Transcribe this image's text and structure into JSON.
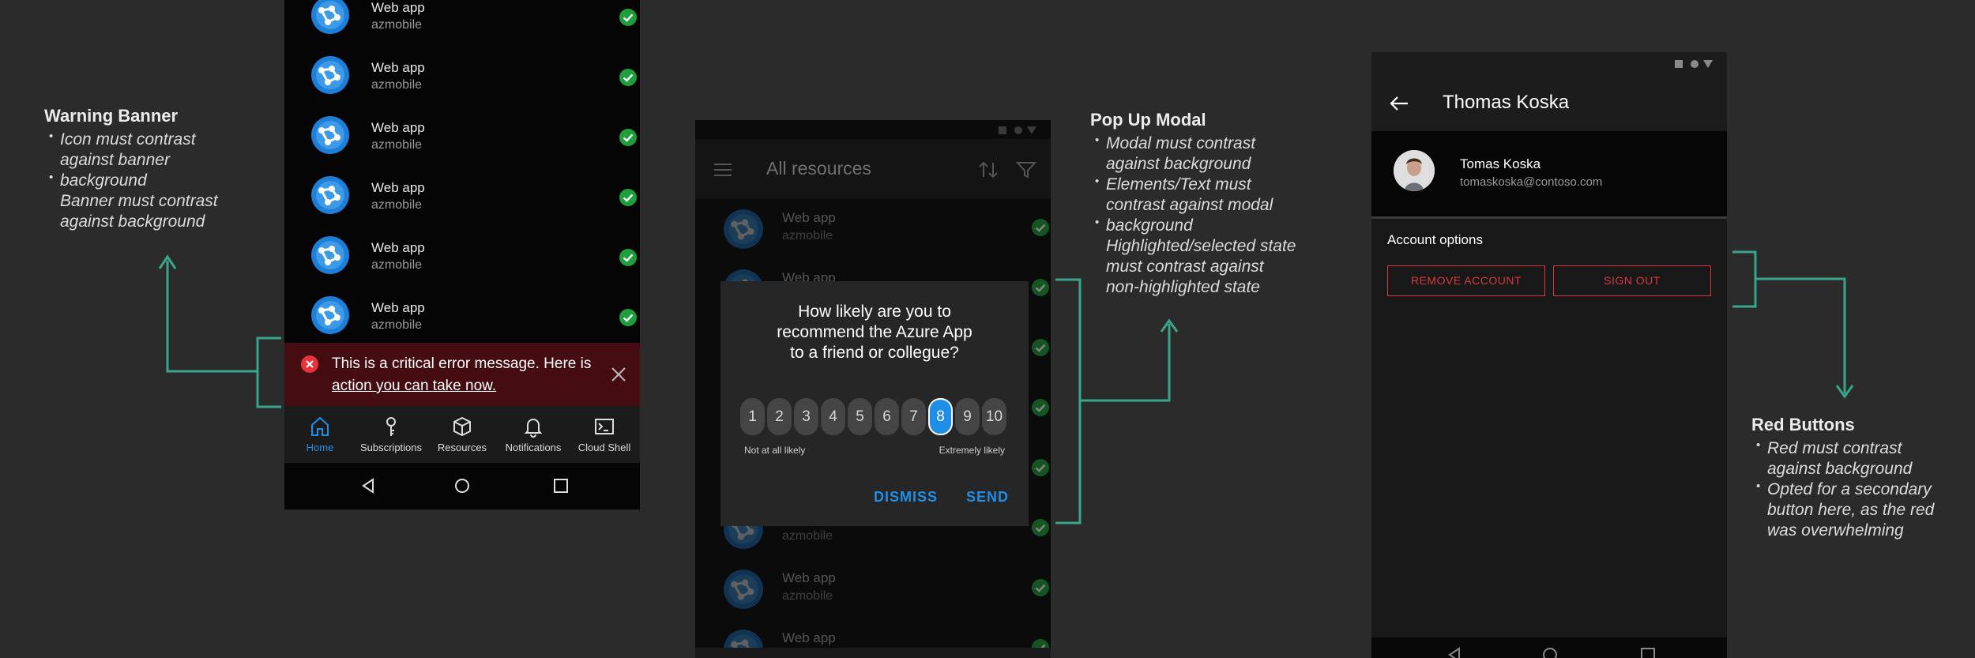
{
  "annotations": {
    "warning": {
      "title": "Warning Banner",
      "b1l1": "Icon must contrast",
      "b1l2": "against banner",
      "b1l3": "background",
      "b2l1": "Banner must contrast",
      "b2l2": "against background"
    },
    "modal": {
      "title": "Pop Up Modal",
      "b1l1": "Modal must contrast",
      "b1l2": "against background",
      "b2l1": "Elements/Text must",
      "b2l2": "contrast against modal",
      "b2l3": "background",
      "b3l1": "Highlighted/selected state",
      "b3l2": "must contrast against",
      "b3l3": "non-highlighted state"
    },
    "red": {
      "title": "Red Buttons",
      "b1l1": "Red must contrast",
      "b1l2": "against background",
      "b2l1": "Opted for a secondary",
      "b2l2": "button here, as the red",
      "b2l3": "was overwhelming"
    }
  },
  "phone1": {
    "rows": [
      {
        "title": "Web app",
        "subtitle": "azmobile"
      },
      {
        "title": "Web app",
        "subtitle": "azmobile"
      },
      {
        "title": "Web app",
        "subtitle": "azmobile"
      },
      {
        "title": "Web app",
        "subtitle": "azmobile"
      },
      {
        "title": "Web app",
        "subtitle": "azmobile"
      },
      {
        "title": "Web app",
        "subtitle": "azmobile"
      }
    ],
    "banner": {
      "line1": "This is a critical error message. Here is",
      "line2": "action you can take now.",
      "icon": "error-circle-icon",
      "color": "#450d12"
    },
    "tabs": [
      {
        "label": "Home",
        "icon": "home-icon",
        "active": true
      },
      {
        "label": "Subscriptions",
        "icon": "key-icon"
      },
      {
        "label": "Resources",
        "icon": "cube-icon"
      },
      {
        "label": "Notifications",
        "icon": "bell-icon"
      },
      {
        "label": "Cloud Shell",
        "icon": "terminal-icon"
      }
    ]
  },
  "phone2": {
    "header_title": "All resources",
    "rows": [
      {
        "title": "Web app",
        "subtitle": "azmobile"
      },
      {
        "title": "Web app",
        "subtitle": ""
      },
      {
        "title": "",
        "subtitle": ""
      },
      {
        "title": "",
        "subtitle": ""
      },
      {
        "title": "",
        "subtitle": ""
      },
      {
        "title": "",
        "subtitle": "azmobile"
      },
      {
        "title": "Web app",
        "subtitle": "azmobile"
      },
      {
        "title": "Web app",
        "subtitle": ""
      }
    ],
    "modal": {
      "question_l1": "How likely are you to",
      "question_l2": "recommend the Azure App",
      "question_l3": "to a friend or collegue?",
      "scale": [
        "1",
        "2",
        "3",
        "4",
        "5",
        "6",
        "7",
        "8",
        "9",
        "10"
      ],
      "selected": "8",
      "low_label": "Not at all likely",
      "high_label": "Extremely likely",
      "dismiss": "DISMISS",
      "send": "SEND",
      "accent": "#1e8fe8"
    }
  },
  "phone3": {
    "header_title": "Thomas Koska",
    "name": "Tomas Koska",
    "email": "tomaskoska@contoso.com",
    "section": "Account options",
    "remove_button": "REMOVE ACCOUNT",
    "signout_button": "SIGN OUT",
    "danger_color": "#d8393e"
  },
  "accent_line_color": "#3aa58a"
}
